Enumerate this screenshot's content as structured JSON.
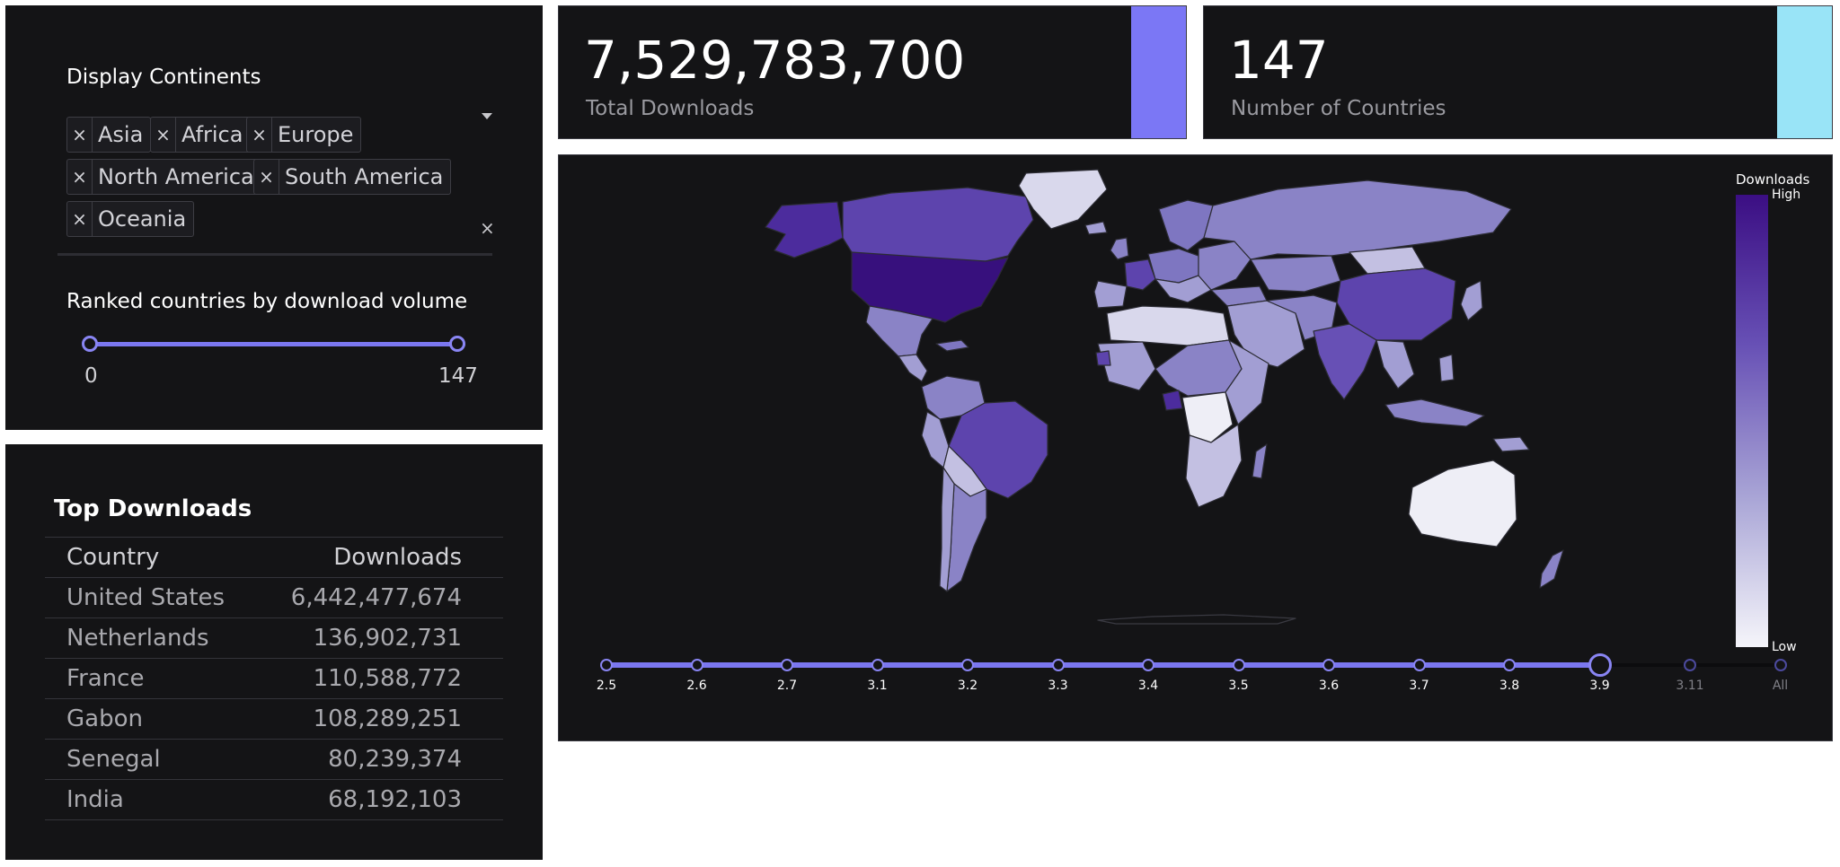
{
  "filters": {
    "continents_label": "Display Continents",
    "continents": [
      "Asia",
      "Africa",
      "Europe",
      "North America",
      "South America",
      "Oceania"
    ],
    "chip_remove_glyph": "×",
    "clear_all_glyph": "×",
    "rank_label": "Ranked countries by download volume",
    "rank_min": "0",
    "rank_max": "147"
  },
  "kpis": {
    "downloads": {
      "value": "7,529,783,700",
      "label": "Total Downloads",
      "accent": "#7b77f5"
    },
    "countries": {
      "value": "147",
      "label": "Number of Countries",
      "accent": "#99e4f7"
    }
  },
  "top_downloads": {
    "title": "Top Downloads",
    "columns": [
      "Country",
      "Downloads"
    ],
    "rows": [
      [
        "United States",
        "6,442,477,674"
      ],
      [
        "Netherlands",
        "136,902,731"
      ],
      [
        "France",
        "110,588,772"
      ],
      [
        "Gabon",
        "108,289,251"
      ],
      [
        "Senegal",
        "80,239,374"
      ],
      [
        "India",
        "68,192,103"
      ]
    ]
  },
  "map": {
    "colorbar_title": "Downloads",
    "colorbar_high": "High",
    "colorbar_low": "Low",
    "colorscale": [
      "#3b0e83",
      "#6750b5",
      "#a9a5d6",
      "#f5f5fa"
    ],
    "version_slider": {
      "steps": [
        "2.5",
        "2.6",
        "2.7",
        "3.1",
        "3.2",
        "3.3",
        "3.4",
        "3.5",
        "3.6",
        "3.7",
        "3.8",
        "3.9",
        "3.11",
        "All"
      ],
      "selected": "3.9"
    }
  }
}
